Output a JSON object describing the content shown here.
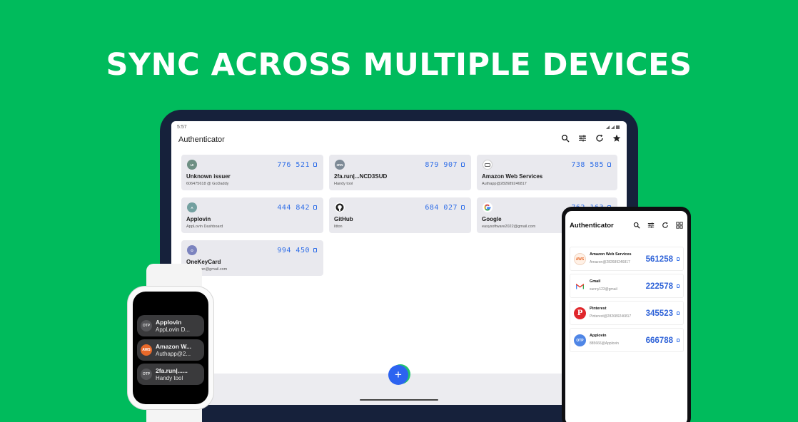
{
  "headline": "SYNC ACROSS MULTIPLE DEVICES",
  "colors": {
    "background": "#00bb5c",
    "accent": "#2f6ee8",
    "fab": "#2c63f0"
  },
  "tablet": {
    "status_time": "5:57",
    "title": "Authenticator",
    "actions": [
      "search-icon",
      "filter-icon",
      "refresh-icon",
      "star-icon"
    ],
    "cards": [
      {
        "avatar": "UI",
        "avatar_color": "#6e8f83",
        "code": "776 521",
        "name": "Unknown issuer",
        "sub": "606475618 @ GoDaddy"
      },
      {
        "avatar": "2RN",
        "avatar_color": "#7d8a96",
        "code": "879 907",
        "name": "2fa.run|...NCD3SUD",
        "sub": "Handy tool"
      },
      {
        "avatar": "",
        "avatar_color": "#ffffff",
        "code": "738 585",
        "name": "Amazon Web Services",
        "sub": "Authapp@282689246817"
      },
      {
        "avatar": "A",
        "avatar_color": "#73a0a0",
        "code": "444 842",
        "name": "Applovin",
        "sub": "AppLovin Dashboard"
      },
      {
        "avatar": "",
        "avatar_color": "#ffffff",
        "code": "684 027",
        "name": "GitHub",
        "sub": "litton"
      },
      {
        "avatar": "",
        "avatar_color": "#ffffff",
        "code": "762 163",
        "name": "Google",
        "sub": "easysoftware2022@gmail.com"
      },
      {
        "avatar": "O",
        "avatar_color": "#7b83bf",
        "code": "994 450",
        "name": "OneKeyCard",
        "sub": "steven.van@gmail.com"
      }
    ],
    "fab_label": "+"
  },
  "phone": {
    "title": "Authenticator",
    "items": [
      {
        "avatar": "AWS",
        "avatar_color": "#fff1e6",
        "name": "Amazon Web Services",
        "sub": "Amazon@282689246817",
        "code": "561258"
      },
      {
        "avatar": "M",
        "avatar_color": "#ffffff",
        "name": "Gmail",
        "sub": "sunny123@gmail",
        "code": "222578"
      },
      {
        "avatar": "P",
        "avatar_color": "#e0262b",
        "name": "Pinterest",
        "sub": "Pinterest@282689246817",
        "code": "345523"
      },
      {
        "avatar": "OTP",
        "avatar_color": "#4f86e6",
        "name": "Applovin",
        "sub": "885666@Applovin",
        "code": "666788"
      }
    ]
  },
  "watch": {
    "items": [
      {
        "avatar": "OTP",
        "avatar_color": "#555558",
        "name": "Applovin",
        "sub": "AppLovin D..."
      },
      {
        "avatar": "AWS",
        "avatar_color": "#e8692a",
        "name": "Amazon W...",
        "sub": "Authapp@2..."
      },
      {
        "avatar": "OTP",
        "avatar_color": "#555558",
        "name": "2fa.run|......",
        "sub": "Handy tool"
      }
    ]
  }
}
